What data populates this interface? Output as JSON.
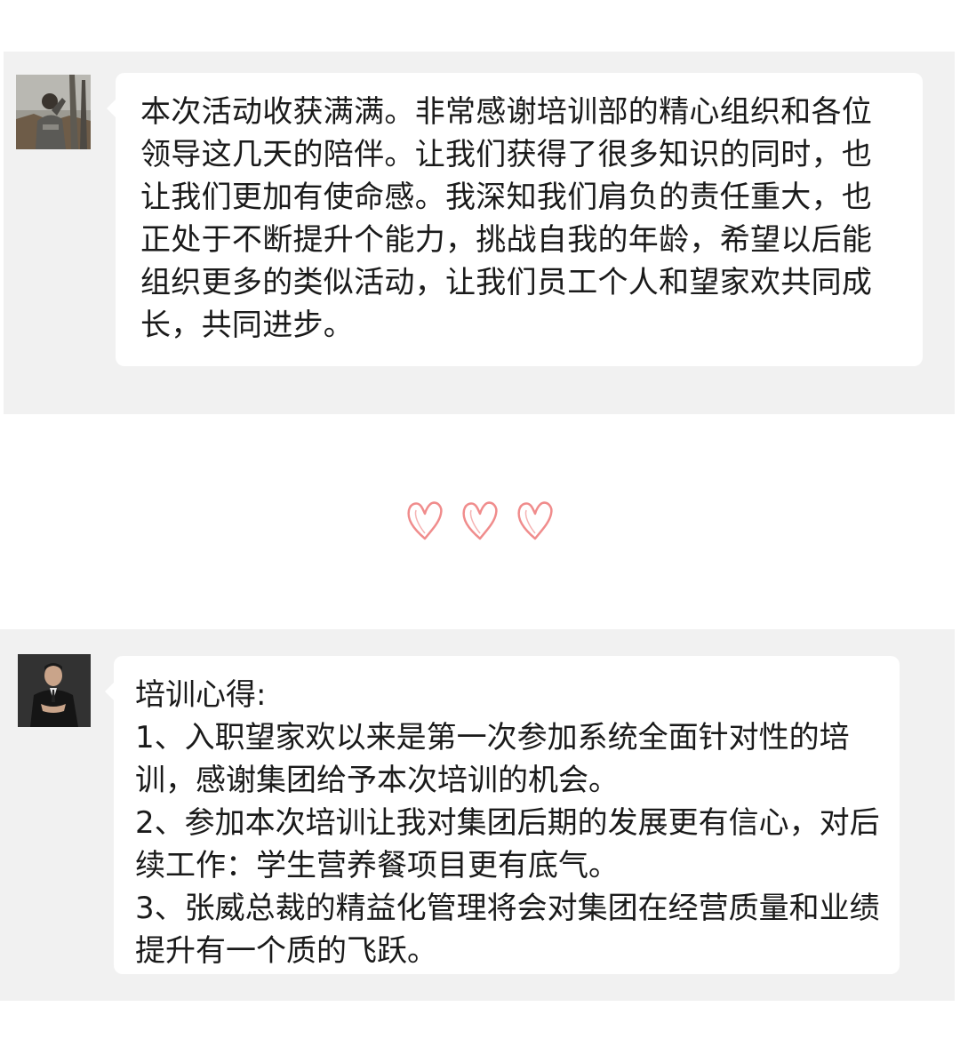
{
  "messages": [
    {
      "avatar_icon": "person-photo-outdoor",
      "lines": [
        "本次活动收获满满。非常感谢培训部的精心组织和各位",
        "领导这几天的陪伴。让我们获得了很多知识的同时，也",
        "让我们更加有使命感。我深知我们肩负的责任重大，也",
        "正处于不断提升个能力，挑战自我的年龄，希望以后能",
        "组织更多的类似活动，让我们员工个人和望家欢共同成",
        "长，共同进步。"
      ]
    },
    {
      "avatar_icon": "person-photo-suit",
      "lines": [
        "培训心得:",
        "1、入职望家欢以来是第一次参加系统全面针对性的培",
        "训，感谢集团给予本次培训的机会。",
        "2、参加本次培训让我对集团后期的发展更有信心，对后",
        "续工作：学生营养餐项目更有底气。",
        "3、张威总裁的精益化管理将会对集团在经营质量和业绩",
        "提升有一个质的飞跃。"
      ]
    }
  ],
  "divider": {
    "icon": "heart-outline-icon",
    "count": 3,
    "color": "#f08c8c"
  },
  "colors": {
    "panel_bg": "#f1f1f1",
    "bubble_bg": "#ffffff",
    "text": "#1a1a1a"
  }
}
